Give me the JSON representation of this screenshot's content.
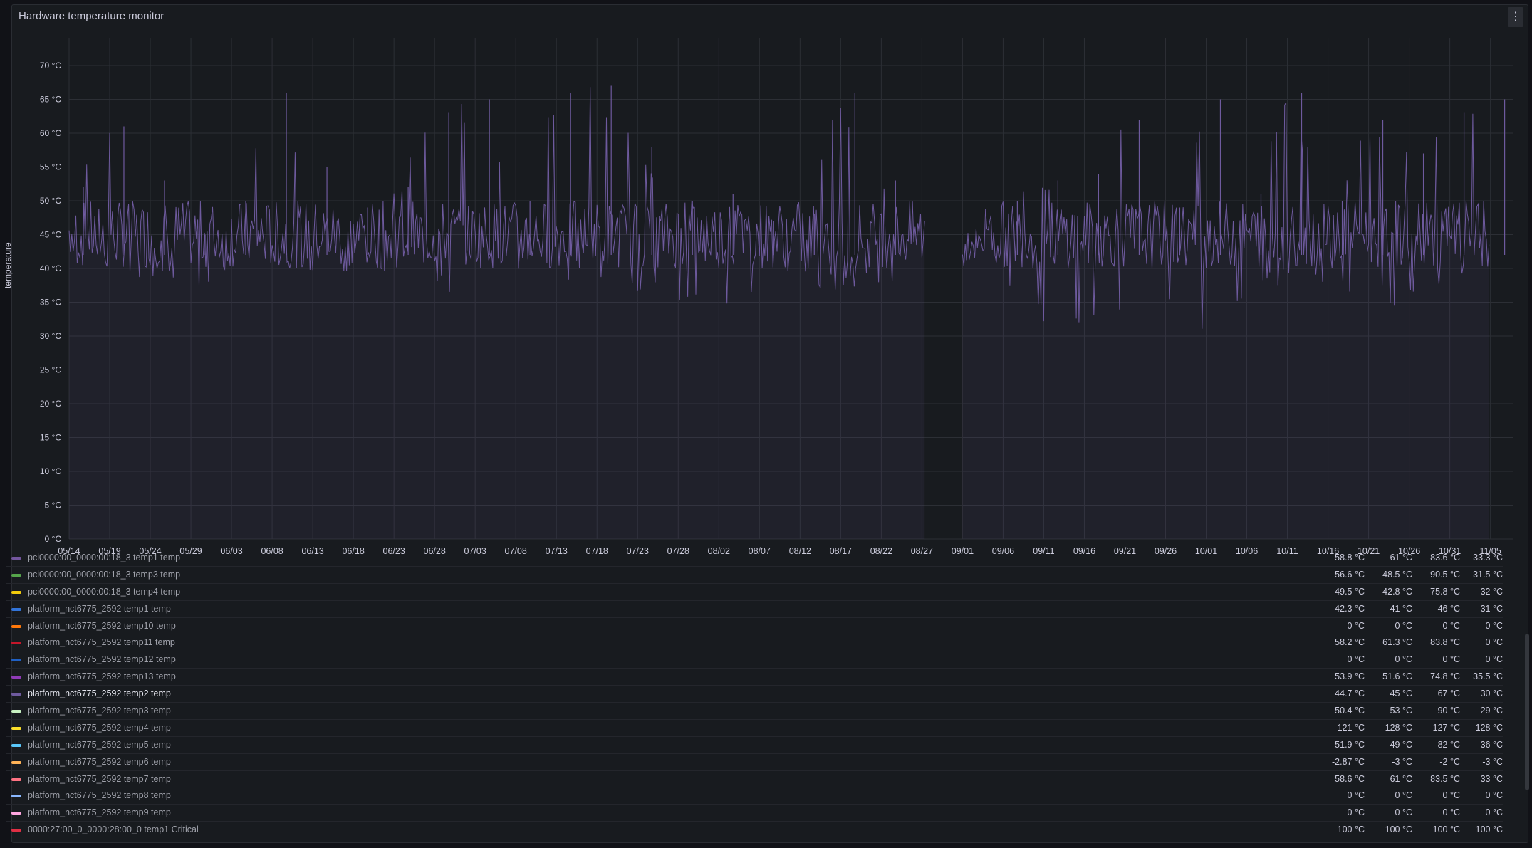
{
  "panel": {
    "title": "Hardware temperature monitor",
    "menu_icon": "vertical-ellipsis-icon"
  },
  "chart_data": {
    "type": "line",
    "ylabel": "temperature",
    "ylim": [
      0,
      74
    ],
    "unit": "°C",
    "y_ticks": [
      "0 °C",
      "5 °C",
      "10 °C",
      "15 °C",
      "20 °C",
      "25 °C",
      "30 °C",
      "35 °C",
      "40 °C",
      "45 °C",
      "50 °C",
      "55 °C",
      "60 °C",
      "65 °C",
      "70 °C"
    ],
    "x_ticks": [
      "05/14",
      "05/19",
      "05/24",
      "05/29",
      "06/03",
      "06/08",
      "06/13",
      "06/18",
      "06/23",
      "06/28",
      "07/03",
      "07/08",
      "07/13",
      "07/18",
      "07/23",
      "07/28",
      "08/02",
      "08/07",
      "08/12",
      "08/17",
      "08/22",
      "08/27",
      "09/01",
      "09/06",
      "09/11",
      "09/16",
      "09/21",
      "09/26",
      "10/01",
      "10/06",
      "10/11",
      "10/16",
      "10/21",
      "10/26",
      "10/31",
      "11/05"
    ],
    "grid": true,
    "series_color": "#6e5a9e",
    "gap": [
      "08/27",
      "09/01"
    ],
    "series": [
      {
        "name": "platform_nct6775_2592 temp2 temp",
        "x": [
          "05/14",
          "05/19",
          "05/24",
          "05/29",
          "06/03",
          "06/08",
          "06/13",
          "06/18",
          "06/23",
          "06/28",
          "07/03",
          "07/08",
          "07/13",
          "07/18",
          "07/23",
          "07/28",
          "08/02",
          "08/07",
          "08/12",
          "08/17",
          "08/22",
          "08/27",
          "09/01",
          "09/06",
          "09/11",
          "09/16",
          "09/21",
          "09/26",
          "10/01",
          "10/06",
          "10/11",
          "10/16",
          "10/21",
          "10/26",
          "10/31",
          "11/05"
        ],
        "values": [
          52,
          61,
          53,
          45,
          50,
          66,
          55,
          49,
          52,
          63,
          65,
          50,
          66,
          67,
          58,
          50,
          51,
          47,
          48,
          66,
          53,
          50,
          42,
          50,
          53,
          54,
          62,
          49,
          65,
          51,
          66,
          50,
          62,
          57,
          63,
          65
        ],
        "min": [
          40,
          39,
          38,
          36,
          38,
          40,
          39,
          38,
          40,
          38,
          33,
          39,
          38,
          37,
          36,
          34,
          33,
          37,
          38,
          36,
          38,
          38,
          35,
          36,
          32,
          31,
          33,
          35,
          30,
          36,
          38,
          37,
          35,
          34,
          36,
          38
        ]
      }
    ]
  },
  "legend": {
    "rows": [
      {
        "name": "pci0000:00_0000:00:18_3 temp1 temp",
        "color": "#73569e",
        "v": [
          "58.8 °C",
          "61 °C",
          "83.6 °C",
          "33.3 °C"
        ]
      },
      {
        "name": "pci0000:00_0000:00:18_3 temp3 temp",
        "color": "#56a64b",
        "v": [
          "56.6 °C",
          "48.5 °C",
          "90.5 °C",
          "31.5 °C"
        ]
      },
      {
        "name": "pci0000:00_0000:00:18_3 temp4 temp",
        "color": "#f2cc0c",
        "v": [
          "49.5 °C",
          "42.8 °C",
          "75.8 °C",
          "32 °C"
        ]
      },
      {
        "name": "platform_nct6775_2592 temp1 temp",
        "color": "#3274d9",
        "v": [
          "42.3 °C",
          "41 °C",
          "46 °C",
          "31 °C"
        ]
      },
      {
        "name": "platform_nct6775_2592 temp10 temp",
        "color": "#ff780a",
        "v": [
          "0 °C",
          "0 °C",
          "0 °C",
          "0 °C"
        ]
      },
      {
        "name": "platform_nct6775_2592 temp11 temp",
        "color": "#c4162a",
        "v": [
          "58.2 °C",
          "61.3 °C",
          "83.8 °C",
          "0 °C"
        ]
      },
      {
        "name": "platform_nct6775_2592 temp12 temp",
        "color": "#1f60c4",
        "v": [
          "0 °C",
          "0 °C",
          "0 °C",
          "0 °C"
        ]
      },
      {
        "name": "platform_nct6775_2592 temp13 temp",
        "color": "#8f3bb8",
        "v": [
          "53.9 °C",
          "51.6 °C",
          "74.8 °C",
          "35.5 °C"
        ]
      },
      {
        "name": "platform_nct6775_2592 temp2 temp",
        "color": "#6e5a9e",
        "v": [
          "44.7 °C",
          "45 °C",
          "67 °C",
          "30 °C"
        ],
        "active": true
      },
      {
        "name": "platform_nct6775_2592 temp3 temp",
        "color": "#c8f2c2",
        "v": [
          "50.4 °C",
          "53 °C",
          "90 °C",
          "29 °C"
        ]
      },
      {
        "name": "platform_nct6775_2592 temp4 temp",
        "color": "#fade2a",
        "v": [
          "-121 °C",
          "-128 °C",
          "127 °C",
          "-128 °C"
        ]
      },
      {
        "name": "platform_nct6775_2592 temp5 temp",
        "color": "#5ac8fa",
        "v": [
          "51.9 °C",
          "49 °C",
          "82 °C",
          "36 °C"
        ]
      },
      {
        "name": "platform_nct6775_2592 temp6 temp",
        "color": "#ffb357",
        "v": [
          "-2.87 °C",
          "-3 °C",
          "-2 °C",
          "-3 °C"
        ]
      },
      {
        "name": "platform_nct6775_2592 temp7 temp",
        "color": "#ff7383",
        "v": [
          "58.6 °C",
          "61 °C",
          "83.5 °C",
          "33 °C"
        ]
      },
      {
        "name": "platform_nct6775_2592 temp8 temp",
        "color": "#8ab8ff",
        "v": [
          "0 °C",
          "0 °C",
          "0 °C",
          "0 °C"
        ]
      },
      {
        "name": "platform_nct6775_2592 temp9 temp",
        "color": "#ffa6e0",
        "v": [
          "0 °C",
          "0 °C",
          "0 °C",
          "0 °C"
        ]
      },
      {
        "name": "0000:27:00_0_0000:28:00_0 temp1 Critical",
        "color": "#e02f44",
        "v": [
          "100 °C",
          "100 °C",
          "100 °C",
          "100 °C"
        ]
      }
    ]
  }
}
